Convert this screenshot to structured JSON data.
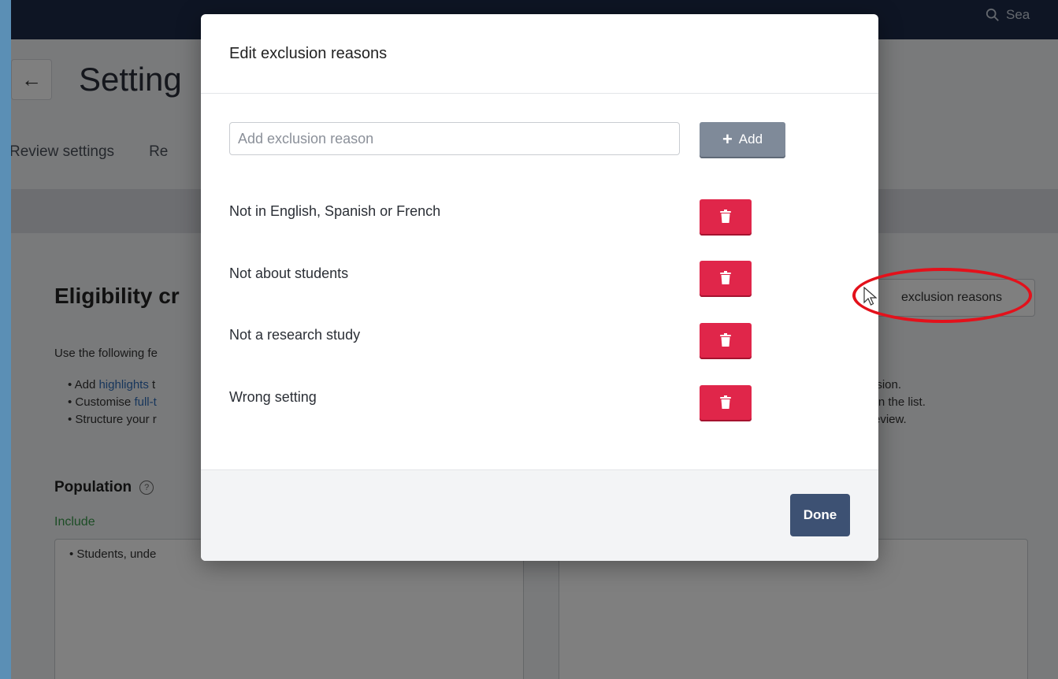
{
  "topbar": {
    "search_text": "Sea"
  },
  "page": {
    "title": "Setting",
    "tabs": [
      "Review settings",
      "Re"
    ],
    "section_title": "Eligibility cr",
    "intro": "Use the following fe",
    "bullets": [
      {
        "prefix": "Add ",
        "link": "highlights",
        "rest": " t"
      },
      {
        "prefix": "Customise ",
        "link": "full-t",
        "rest": ""
      },
      {
        "prefix": "Structure your r",
        "link": "",
        "rest": ""
      }
    ],
    "right_bullets": [
      "usion.",
      "wn the list.",
      "review."
    ],
    "exclusion_button_label": "exclusion reasons",
    "population_title": "Population",
    "include_label": "Include",
    "include_text": "• Students, unde",
    "exclude_text": ""
  },
  "modal": {
    "title": "Edit exclusion reasons",
    "input_placeholder": "Add exclusion reason",
    "input_value": "",
    "add_label": "Add",
    "reasons": [
      "Not in English, Spanish or French",
      "Not about students",
      "Not a research study",
      "Wrong setting"
    ],
    "done_label": "Done"
  },
  "colors": {
    "topbar": "#1c2b49",
    "delete": "#e0264a",
    "add": "#7f8a99",
    "done": "#3d5173",
    "annotation": "#e3111b",
    "include": "#3a9a4c"
  },
  "icons": [
    "search-icon",
    "back-arrow-icon",
    "help-icon",
    "plus-icon",
    "trash-icon",
    "cursor-icon"
  ]
}
